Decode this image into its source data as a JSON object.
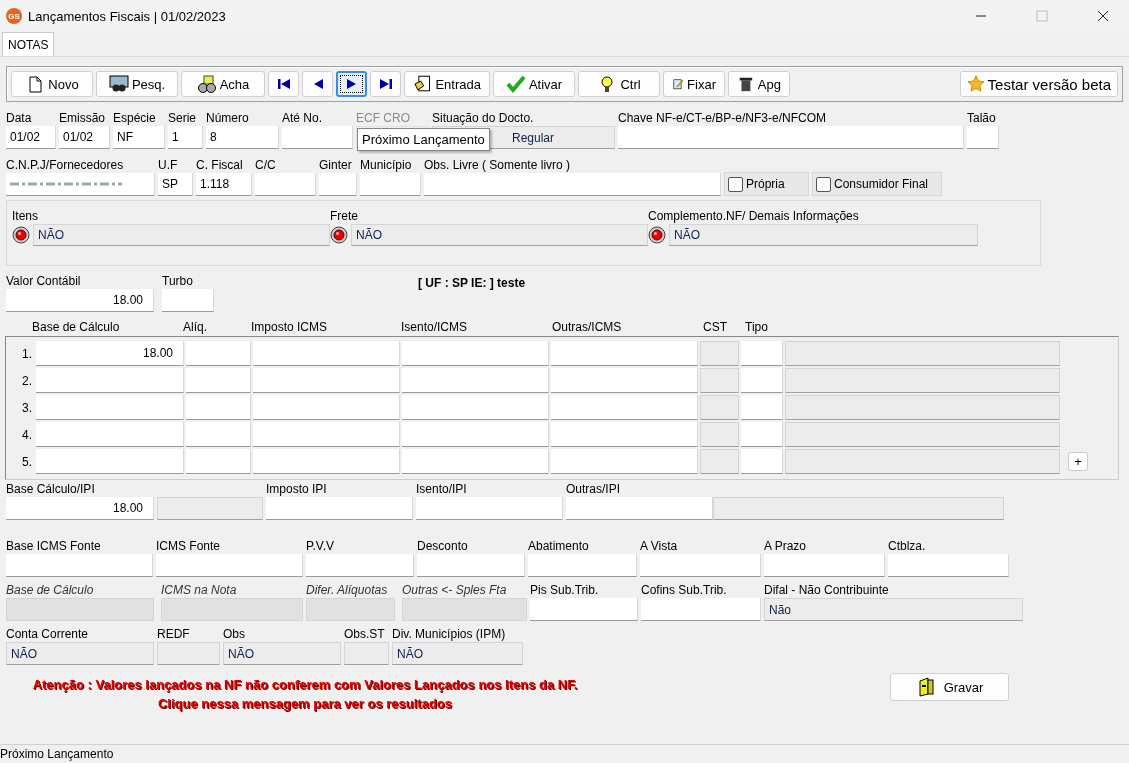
{
  "window": {
    "logo": "GS",
    "title": "Lançamentos Fiscais |  01/02/2023"
  },
  "tabs": [
    {
      "label": "NOTAS",
      "selected": true
    }
  ],
  "toolbar": [
    {
      "kind": "text",
      "label": "Novo"
    },
    {
      "kind": "text",
      "label": "Pesq."
    },
    {
      "kind": "text",
      "label": "Acha"
    },
    {
      "kind": "nav",
      "selected": false
    },
    {
      "kind": "nav",
      "selected": false
    },
    {
      "kind": "nav",
      "selected": true
    },
    {
      "kind": "nav",
      "selected": false
    },
    {
      "kind": "text",
      "label": "Entrada"
    },
    {
      "kind": "text",
      "label": "Ativar"
    },
    {
      "kind": "text",
      "label": "Ctrl"
    },
    {
      "kind": "text",
      "label": "Fixar"
    },
    {
      "kind": "text",
      "label": "Apg"
    }
  ],
  "beta_button": "Testar versão beta",
  "tooltip": "Próximo  Lançamento",
  "header_rows": [
    {
      "fields": [
        {
          "label": "Data",
          "value": "01/02",
          "kind": "input"
        },
        {
          "label": "Emissão",
          "value": "01/02",
          "kind": "input"
        },
        {
          "label": "Espécie",
          "value": "NF",
          "kind": "input"
        },
        {
          "label": "Serie",
          "value": "1",
          "kind": "input"
        },
        {
          "label": "Número",
          "value": "8",
          "kind": "input"
        },
        {
          "label": "Até No.",
          "kind": "input"
        },
        {
          "label": "ECF CRO",
          "kind": "disabled"
        },
        {
          "kind": "disabled"
        },
        {
          "label": "Situação do Docto.",
          "kind": "readonly"
        },
        {
          "value": "Regular",
          "kind": "readonly"
        },
        {
          "label": "Chave NF-e/CT-e/BP-e/NF3-e/NFCOM",
          "kind": "input"
        },
        {
          "label": "Talão",
          "kind": "input"
        }
      ]
    },
    {
      "fields": [
        {
          "label": "C.N.P.J/Fornecedores",
          "kind": "redacted"
        },
        {
          "label": "U.F",
          "value": "SP",
          "kind": "input"
        },
        {
          "label": "C. Fiscal",
          "value": "1.118",
          "kind": "input"
        },
        {
          "label": "C/C",
          "kind": "input"
        },
        {
          "label": "Ginter",
          "kind": "input"
        },
        {
          "label": "Município",
          "kind": "input"
        },
        {
          "label": "Obs. Livre ( Somente livro )",
          "kind": "input"
        },
        {
          "label": "Própria",
          "kind": "check",
          "checked": false
        },
        {
          "label": "Consumidor Final",
          "kind": "check",
          "checked": false
        }
      ]
    }
  ],
  "flags": [
    {
      "label": "Itens",
      "value": "NÃO"
    },
    {
      "label": "Frete",
      "value": "NÃO"
    },
    {
      "label": "Complemento.NF/ Demais Informações",
      "value": "NÃO"
    }
  ],
  "totals_row": {
    "fields": [
      {
        "label": "Valor Contábil",
        "value": "18.00",
        "kind": "amount"
      },
      {
        "label": "Turbo",
        "kind": "input"
      }
    ]
  },
  "ie_note": "[ UF : SP IE:  ] teste",
  "icms_table": {
    "columns": [
      "Base de Cálculo",
      "Alíq.",
      "Imposto ICMS",
      "Isento/ICMS",
      "Outras/ICMS",
      "CST",
      "Tipo"
    ],
    "rows": [
      {
        "number": "1.",
        "base": "18.00"
      },
      {
        "number": "2."
      },
      {
        "number": "3."
      },
      {
        "number": "4."
      },
      {
        "number": "5."
      }
    ],
    "add_button": "+"
  },
  "lower_rows": [
    {
      "fields": [
        {
          "label": "Base Cálculo/IPI",
          "value": "18.00",
          "kind": "amount"
        },
        {
          "kind": "readonly"
        },
        {
          "label": "Imposto IPI",
          "kind": "input"
        },
        {
          "label": "Isento/IPI",
          "kind": "input"
        },
        {
          "label": "Outras/IPI",
          "kind": "input"
        },
        {
          "kind": "readonly"
        }
      ]
    },
    {
      "fields": [
        {
          "label": "Base ICMS Fonte",
          "kind": "input"
        },
        {
          "label": "ICMS Fonte",
          "kind": "input"
        },
        {
          "label": "P.V.V",
          "kind": "input"
        },
        {
          "label": "Desconto",
          "kind": "input"
        },
        {
          "label": "Abatimento",
          "kind": "input"
        },
        {
          "label": "A Vista",
          "kind": "input"
        },
        {
          "label": "A Prazo",
          "kind": "input"
        },
        {
          "label": "Ctblza.",
          "kind": "input"
        }
      ]
    },
    {
      "fields": [
        {
          "label": "Base de Cálculo",
          "kind": "computed"
        },
        {
          "label": "ICMS na Nota",
          "kind": "computed"
        },
        {
          "label": "Difer. Alíquotas",
          "kind": "computed"
        },
        {
          "label": "Outras <- Sples Fta",
          "kind": "computed"
        },
        {
          "label": "Pis Sub.Trib.",
          "kind": "input"
        },
        {
          "label": "Cofins Sub.Trib.",
          "kind": "input"
        },
        {
          "label": "Difal - Não Contribuinte",
          "value": "Não",
          "kind": "readonly"
        }
      ]
    },
    {
      "fields": [
        {
          "label": "Conta Corrente",
          "value": "NÃO",
          "kind": "readonly"
        },
        {
          "label": "REDF",
          "kind": "readonly"
        },
        {
          "label": "Obs",
          "value": "NÃO",
          "kind": "readonly"
        },
        {
          "label": "Obs.ST",
          "kind": "readonly"
        },
        {
          "label": "Div. Municípios (IPM)",
          "value": "NÃO",
          "kind": "readonly"
        }
      ]
    }
  ],
  "warning": "Atenção : Valores lançados na NF não conferem com Valores Lançados nos Itens da NF.\nClique nessa mensagem para ver os resultados",
  "save_button": "Gravar",
  "status_bar": "Próximo  Lançamento"
}
